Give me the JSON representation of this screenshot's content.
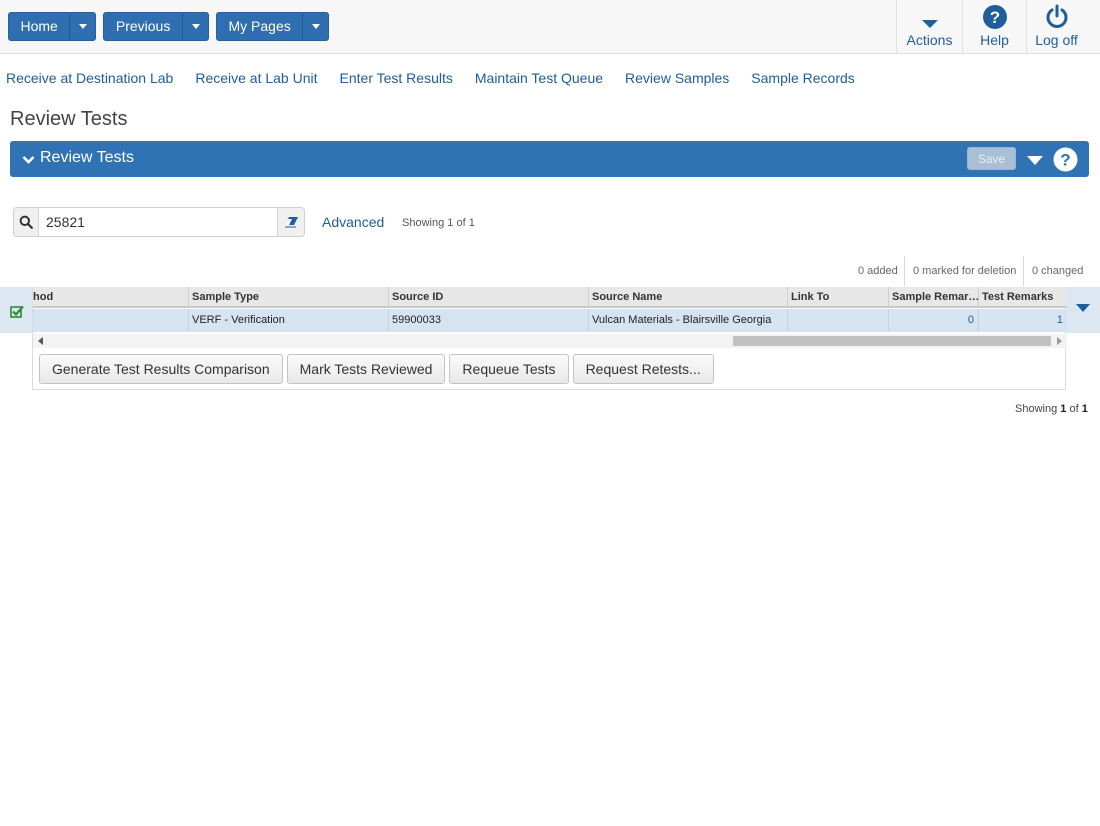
{
  "topbar": {
    "home": "Home",
    "previous": "Previous",
    "my_pages": "My Pages",
    "actions": "Actions",
    "help": "Help",
    "logoff": "Log off"
  },
  "nav": {
    "links": [
      "Receive at Destination Lab",
      "Receive at Lab Unit",
      "Enter Test Results",
      "Maintain Test Queue",
      "Review Samples",
      "Sample Records"
    ]
  },
  "page": {
    "title": "Review Tests"
  },
  "panel": {
    "title": "Review Tests",
    "save": "Save"
  },
  "search": {
    "value": "25821",
    "advanced": "Advanced",
    "showing_prefix": "Showing ",
    "showing_current": "1",
    "showing_mid": " of ",
    "showing_total": "1"
  },
  "counters": {
    "added": "0 added",
    "deletion": "0 marked for deletion",
    "changed": "0 changed"
  },
  "grid": {
    "headers": [
      "hod",
      "Sample Type",
      "Source ID",
      "Source Name",
      "Link To",
      "Sample Remar…",
      "Test Remarks"
    ],
    "row": [
      "",
      "VERF - Verification",
      "59900033",
      "Vulcan Materials - Blairsville Georgia",
      "",
      "0",
      "1"
    ]
  },
  "buttons": {
    "compare": "Generate Test Results Comparison",
    "reviewed": "Mark Tests Reviewed",
    "requeue": "Requeue Tests",
    "retests": "Request Retests..."
  },
  "colors": {
    "primary": "#2f73b5",
    "link": "#1f5d9b",
    "row_selected": "#d6e3f0",
    "check": "#2e8b3a"
  }
}
